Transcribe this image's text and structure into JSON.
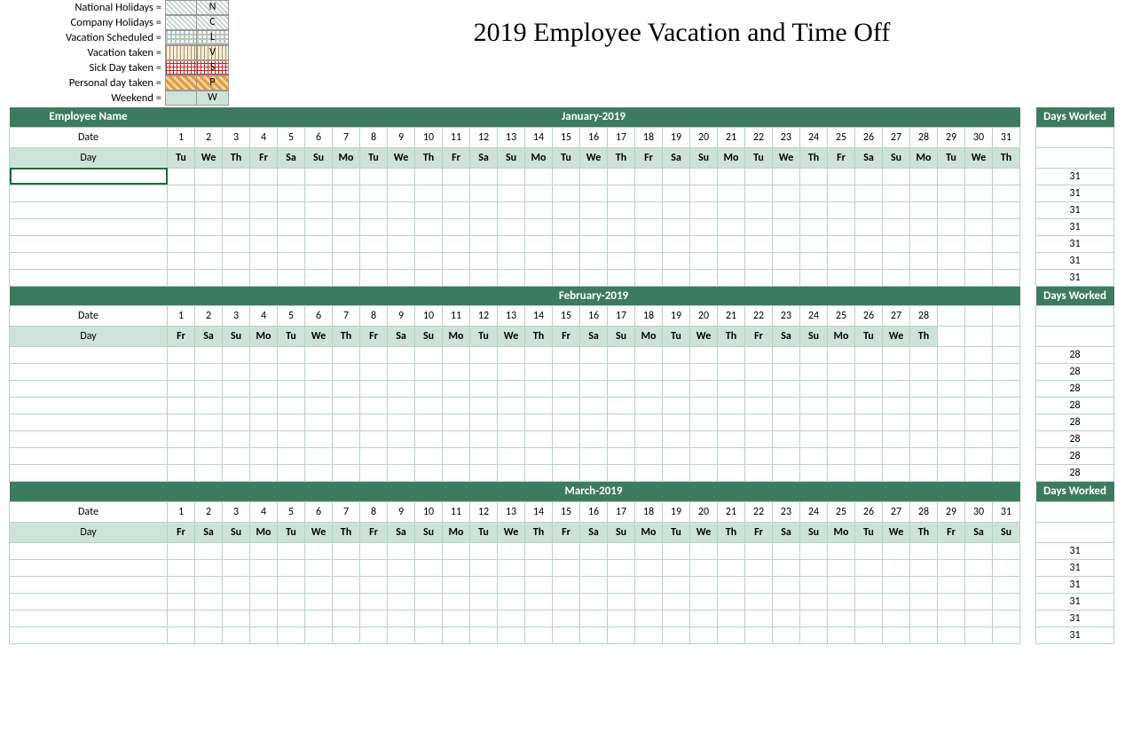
{
  "title": "2019 Employee Vacation and Time Off",
  "legend": [
    {
      "label": "National Holidays =",
      "code": "N",
      "pat": "pat-hatch"
    },
    {
      "label": "Company Holidays =",
      "code": "C",
      "pat": "pat-hatch"
    },
    {
      "label": "Vacation Scheduled =",
      "code": "L",
      "pat": "pat-check"
    },
    {
      "label": "Vacation taken =",
      "code": "V",
      "pat": "pat-vert"
    },
    {
      "label": "Sick Day taken =",
      "code": "S",
      "pat": "pat-red"
    },
    {
      "label": "Personal day taken =",
      "code": "P",
      "pat": "pat-orange"
    },
    {
      "label": "Weekend =",
      "code": "W",
      "pat": "pat-green"
    }
  ],
  "headers": {
    "employee_name": "Employee Name",
    "date": "Date",
    "day": "Day",
    "days_worked": "Days Worked"
  },
  "months": [
    {
      "title": "January-2019",
      "ndays": 31,
      "rows": 7,
      "days_value": 31,
      "dow": [
        "Tu",
        "We",
        "Th",
        "Fr",
        "Sa",
        "Su",
        "Mo",
        "Tu",
        "We",
        "Th",
        "Fr",
        "Sa",
        "Su",
        "Mo",
        "Tu",
        "We",
        "Th",
        "Fr",
        "Sa",
        "Su",
        "Mo",
        "Tu",
        "We",
        "Th",
        "Fr",
        "Sa",
        "Su",
        "Mo",
        "Tu",
        "We",
        "Th"
      ]
    },
    {
      "title": "February-2019",
      "ndays": 28,
      "rows": 8,
      "days_value": 28,
      "dow": [
        "Fr",
        "Sa",
        "Su",
        "Mo",
        "Tu",
        "We",
        "Th",
        "Fr",
        "Sa",
        "Su",
        "Mo",
        "Tu",
        "We",
        "Th",
        "Fr",
        "Sa",
        "Su",
        "Mo",
        "Tu",
        "We",
        "Th",
        "Fr",
        "Sa",
        "Su",
        "Mo",
        "Tu",
        "We",
        "Th"
      ]
    },
    {
      "title": "March-2019",
      "ndays": 31,
      "rows": 6,
      "days_value": 31,
      "dow": [
        "Fr",
        "Sa",
        "Su",
        "Mo",
        "Tu",
        "We",
        "Th",
        "Fr",
        "Sa",
        "Su",
        "Mo",
        "Tu",
        "We",
        "Th",
        "Fr",
        "Sa",
        "Su",
        "Mo",
        "Tu",
        "We",
        "Th",
        "Fr",
        "Sa",
        "Su",
        "Mo",
        "Tu",
        "We",
        "Th",
        "Fr",
        "Sa",
        "Su"
      ]
    }
  ]
}
